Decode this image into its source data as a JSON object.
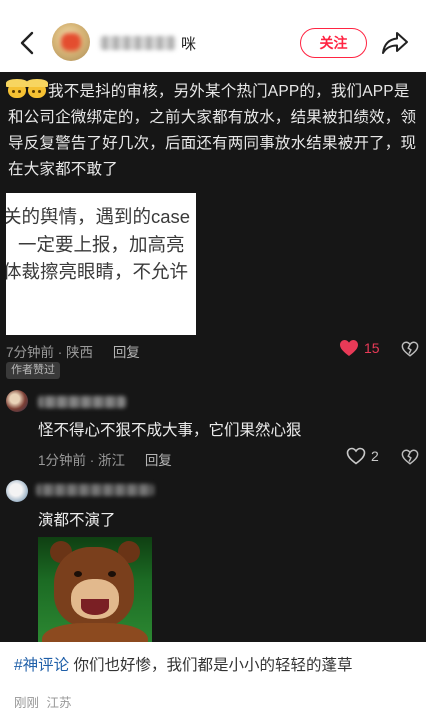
{
  "header": {
    "username_suffix": "咪",
    "follow_label": "关注"
  },
  "post_image": {
    "main_text": "我不是抖的审核，另外某个热门APP的，我们APP是和公司企微绑定的，之前大家都有放水，结果被扣绩效，领导反复警告了好几次，后面还有两同事放水结果被开了，现在大家都不敢了",
    "nested_lines": [
      "关的舆情，遇到的case",
      "一定要上报，加高亮",
      "体裁擦亮眼睛，不允许"
    ],
    "comment1": {
      "time": "7分钟前",
      "location": "陕西",
      "reply_label": "回复",
      "likes": "15",
      "badge": "作者赞过"
    },
    "comment2": {
      "text": "怪不得心不狠不成大事，它们果然心狠",
      "time": "1分钟前",
      "location": "浙江",
      "reply_label": "回复",
      "likes": "2"
    },
    "comment3": {
      "text": "演都不演了"
    }
  },
  "caption": {
    "tag": "#神评论",
    "text": "你们也好惨，我们都是小小的轻轻的蓬草",
    "time": "刚刚",
    "location": "江苏"
  },
  "colors": {
    "accent": "#ff2442",
    "like_red": "#e83a57",
    "tag_blue": "#1f5fa8"
  }
}
